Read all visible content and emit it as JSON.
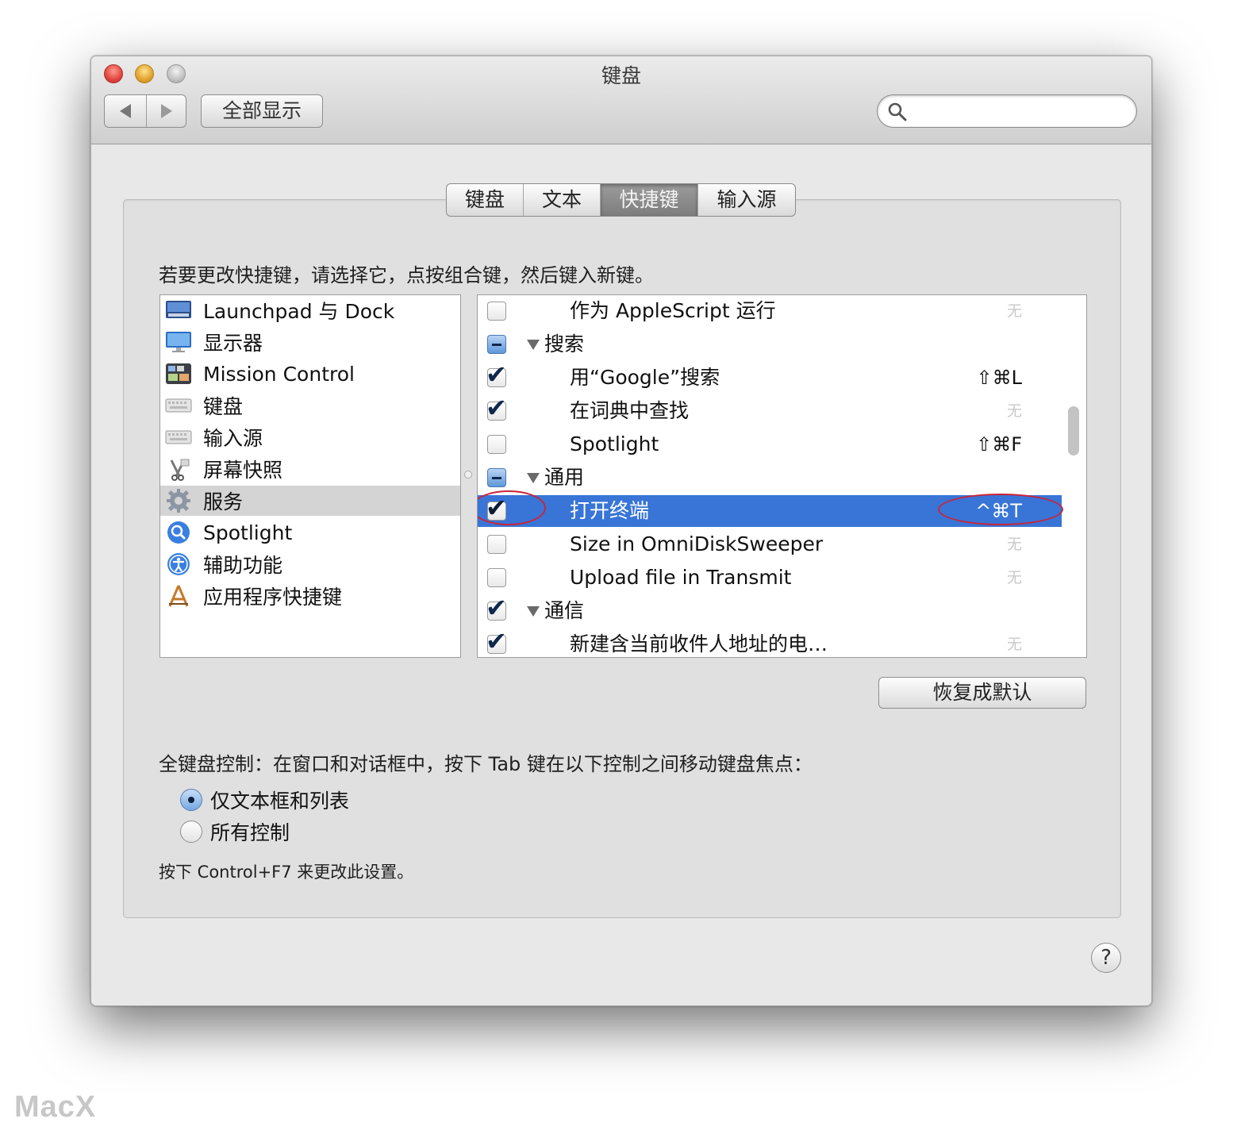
{
  "window": {
    "title": "键盘"
  },
  "toolbar": {
    "show_all_label": "全部显示",
    "search": {
      "value": "",
      "placeholder": ""
    }
  },
  "tabs": [
    {
      "label": "键盘",
      "active": false
    },
    {
      "label": "文本",
      "active": false
    },
    {
      "label": "快捷键",
      "active": true
    },
    {
      "label": "输入源",
      "active": false
    }
  ],
  "instruction": "若要更改快捷键，请选择它，点按组合键，然后键入新键。",
  "categories": [
    {
      "label": "Launchpad 与 Dock",
      "icon": "launchpad-dock-icon",
      "selected": false
    },
    {
      "label": "显示器",
      "icon": "display-icon",
      "selected": false
    },
    {
      "label": "Mission Control",
      "icon": "mission-control-icon",
      "selected": false
    },
    {
      "label": "键盘",
      "icon": "keyboard-icon",
      "selected": false
    },
    {
      "label": "输入源",
      "icon": "input-source-icon",
      "selected": false
    },
    {
      "label": "屏幕快照",
      "icon": "screenshot-icon",
      "selected": false
    },
    {
      "label": "服务",
      "icon": "gear-icon",
      "selected": true
    },
    {
      "label": "Spotlight",
      "icon": "spotlight-icon",
      "selected": false
    },
    {
      "label": "辅助功能",
      "icon": "accessibility-icon",
      "selected": false
    },
    {
      "label": "应用程序快捷键",
      "icon": "app-shortcuts-icon",
      "selected": false
    }
  ],
  "shortcuts": [
    {
      "label": "作为 AppleScript 运行",
      "checkbox": "unchecked",
      "group": false,
      "shortcut": "无",
      "selected": false
    },
    {
      "label": "搜索",
      "checkbox": "mixed",
      "group": true,
      "shortcut": "",
      "selected": false
    },
    {
      "label": "用“Google”搜索",
      "checkbox": "checked",
      "group": false,
      "shortcut": "⇧⌘L",
      "selected": false
    },
    {
      "label": "在词典中查找",
      "checkbox": "checked",
      "group": false,
      "shortcut": "无",
      "selected": false
    },
    {
      "label": "Spotlight",
      "checkbox": "unchecked",
      "group": false,
      "shortcut": "⇧⌘F",
      "selected": false
    },
    {
      "label": "通用",
      "checkbox": "mixed",
      "group": true,
      "shortcut": "",
      "selected": false
    },
    {
      "label": "打开终端",
      "checkbox": "checked",
      "group": false,
      "shortcut": "^⌘T",
      "selected": true
    },
    {
      "label": "Size in OmniDiskSweeper",
      "checkbox": "unchecked",
      "group": false,
      "shortcut": "无",
      "selected": false
    },
    {
      "label": "Upload file in Transmit",
      "checkbox": "unchecked",
      "group": false,
      "shortcut": "无",
      "selected": false
    },
    {
      "label": "通信",
      "checkbox": "checked",
      "group": true,
      "shortcut": "",
      "selected": false
    },
    {
      "label": "新建含当前收件人地址的电…",
      "checkbox": "checked",
      "group": false,
      "shortcut": "无",
      "selected": false
    }
  ],
  "restore_button_label": "恢复成默认",
  "full_keyboard_access": {
    "label": "全键盘控制：在窗口和对话框中，按下 Tab 键在以下控制之间移动键盘焦点：",
    "options": [
      {
        "label": "仅文本框和列表",
        "selected": true
      },
      {
        "label": "所有控制",
        "selected": false
      }
    ],
    "note": "按下 Control+F7 来更改此设置。"
  },
  "help_label": "?",
  "watermark": "MacX",
  "colors": {
    "selection": "#3875d7",
    "annotation": "#c9243a"
  }
}
